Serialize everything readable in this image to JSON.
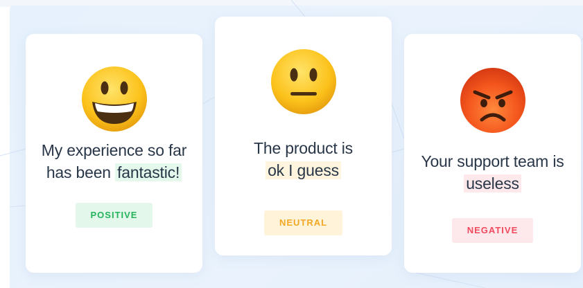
{
  "cards": [
    {
      "sentiment": "positive",
      "emoji": "grinning-face-icon",
      "text_prefix": "My experience so far has been",
      "text_highlight": "fantastic!",
      "badge": "POSITIVE",
      "accent_color": "#25b45c",
      "badge_bg": "#e3f7ea",
      "highlight_bg": "#e4f8ec"
    },
    {
      "sentiment": "neutral",
      "emoji": "neutral-face-icon",
      "text_prefix": "The product is",
      "text_highlight": "ok I guess",
      "badge": "NEUTRAL",
      "accent_color": "#f3a825",
      "badge_bg": "#fff3d9",
      "highlight_bg": "#fff5de"
    },
    {
      "sentiment": "negative",
      "emoji": "angry-face-icon",
      "text_prefix": "Your support team is",
      "text_highlight": "useless",
      "badge": "NEGATIVE",
      "accent_color": "#ef4a5e",
      "badge_bg": "#fde8eb",
      "highlight_bg": "#fde9ec"
    }
  ]
}
